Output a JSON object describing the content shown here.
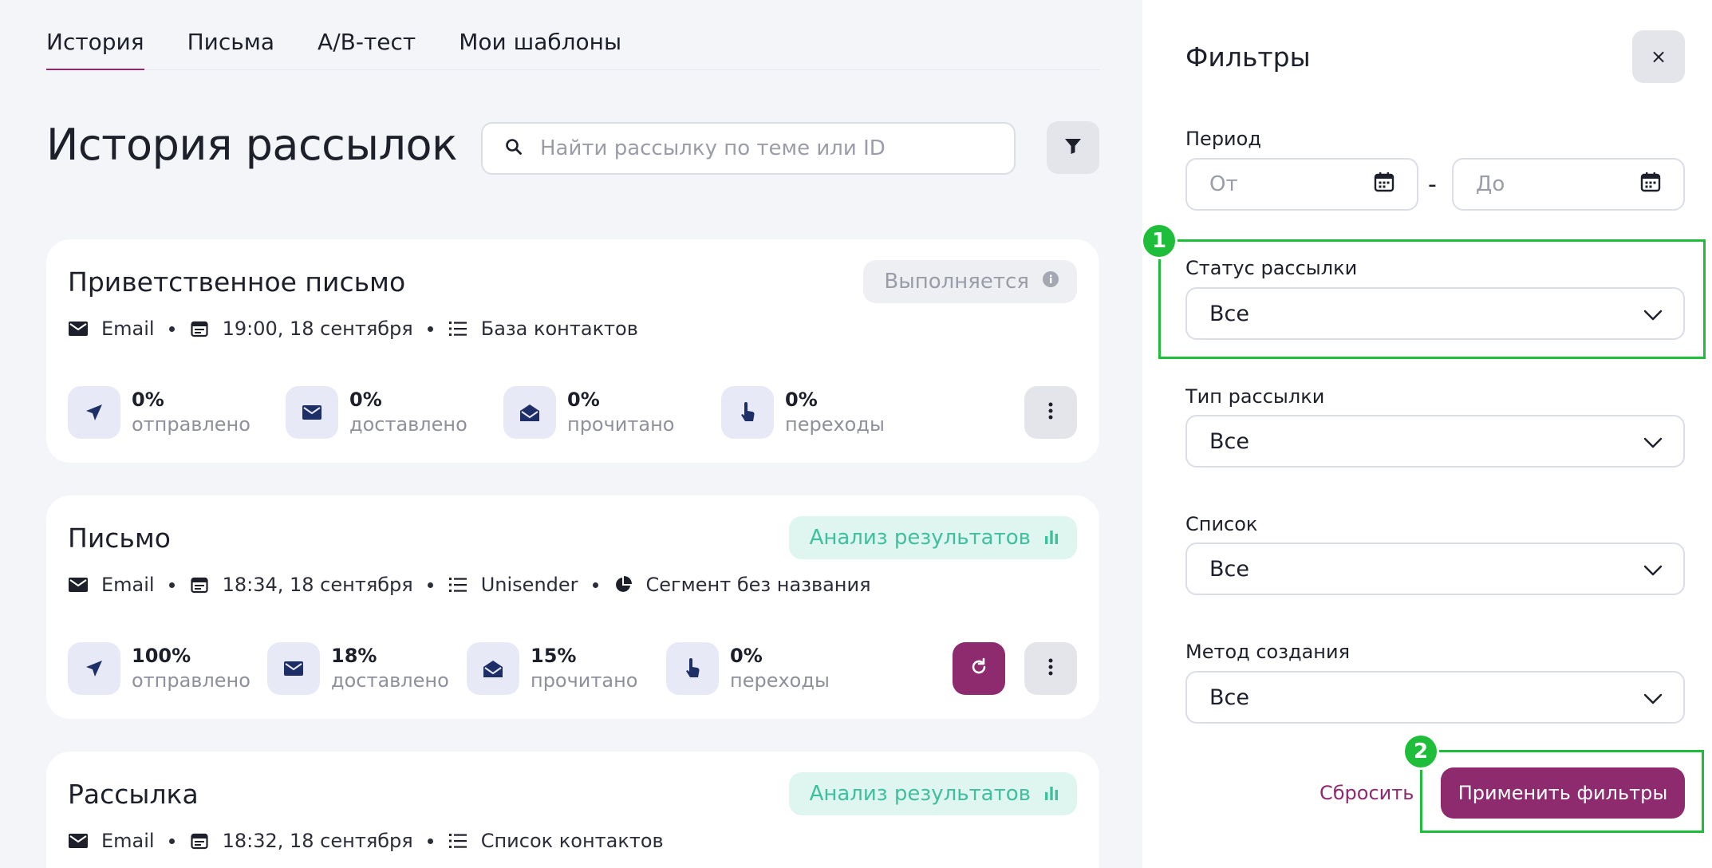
{
  "tabs": [
    {
      "label": "История",
      "active": true
    },
    {
      "label": "Письма",
      "active": false
    },
    {
      "label": "A/B-тест",
      "active": false
    },
    {
      "label": "Мои шаблоны",
      "active": false
    }
  ],
  "page_title": "История рассылок",
  "search": {
    "placeholder": "Найти рассылку по теме или ID",
    "value": ""
  },
  "campaigns": [
    {
      "title": "Приветственное письмо",
      "status": "Выполняется",
      "channel": "Email",
      "datetime": "19:00, 18 сентября",
      "list": "База контактов",
      "stats": [
        {
          "value": "0%",
          "label": "отправлено"
        },
        {
          "value": "0%",
          "label": "доставлено"
        },
        {
          "value": "0%",
          "label": "прочитано"
        },
        {
          "value": "0%",
          "label": "переходы"
        }
      ]
    },
    {
      "title": "Письмо",
      "status": "Анализ результатов",
      "channel": "Email",
      "datetime": "18:34, 18 сентября",
      "list": "Unisender",
      "segment": "Сегмент без названия",
      "stats": [
        {
          "value": "100%",
          "label": "отправлено"
        },
        {
          "value": "18%",
          "label": "доставлено"
        },
        {
          "value": "15%",
          "label": "прочитано"
        },
        {
          "value": "0%",
          "label": "переходы"
        }
      ]
    },
    {
      "title": "Рассылка",
      "status": "Анализ результатов",
      "channel": "Email",
      "datetime": "18:32, 18 сентября",
      "list": "Список контактов"
    }
  ],
  "filters": {
    "title": "Фильтры",
    "close_label": "×",
    "period_label": "Период",
    "from_placeholder": "От",
    "to_placeholder": "До",
    "date_separator": "-",
    "status_label": "Статус рассылки",
    "status_value": "Все",
    "type_label": "Тип рассылки",
    "type_value": "Все",
    "list_label": "Список",
    "list_value": "Все",
    "method_label": "Метод создания",
    "method_value": "Все",
    "reset_label": "Сбросить",
    "apply_label": "Применить фильтры"
  },
  "annotations": [
    {
      "number": "1"
    },
    {
      "number": "2"
    }
  ],
  "colors": {
    "accent": "#8d2b6e",
    "highlight": "#1fbe3a",
    "success_bg": "#dff5ef",
    "success_text": "#3fbf9e"
  }
}
